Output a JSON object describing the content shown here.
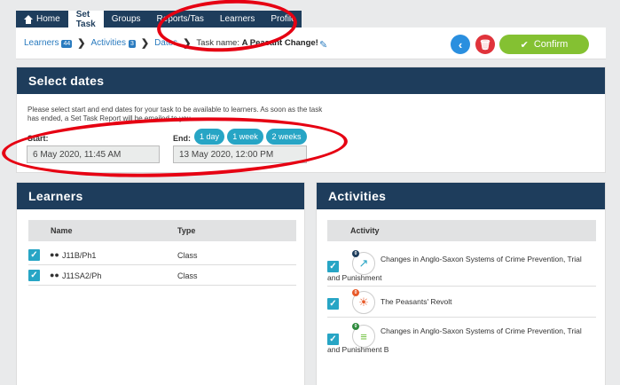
{
  "nav": {
    "tabs": [
      {
        "label": "Home",
        "icon": "home-icon"
      },
      {
        "label": "Set Task"
      },
      {
        "label": "Groups"
      },
      {
        "label": "Reports/Tas"
      },
      {
        "label": "Learners"
      },
      {
        "label": "Profile"
      }
    ],
    "active_tab": "Set Task"
  },
  "breadcrumb": {
    "learners": "Learners",
    "learners_count": "44",
    "activities": "Activities",
    "activities_count": "3",
    "dates": "Dates",
    "task_label": "Task name:",
    "task_name": "A Peasant Change!"
  },
  "actions": {
    "back_icon": "chevron-left-icon",
    "delete_icon": "trash-icon",
    "confirm_label": "Confirm"
  },
  "select_dates": {
    "title": "Select dates",
    "description": "Please select start and end dates for your task to be available to learners. As soon as the task has ended, a Set Task Report will be emailed to you.",
    "start_label": "Start:",
    "end_label": "End:",
    "quick_options": [
      "1 day",
      "1 week",
      "2 weeks"
    ],
    "start_value": "6 May 2020, 11:45 AM",
    "end_value": "13 May 2020, 12:00 PM"
  },
  "learners": {
    "title": "Learners",
    "columns": [
      "Name",
      "Type"
    ],
    "rows": [
      {
        "name": "J11B/Ph1",
        "type": "Class",
        "checked": true
      },
      {
        "name": "J11SA2/Ph",
        "type": "Class",
        "checked": true
      }
    ]
  },
  "activities": {
    "title": "Activities",
    "column": "Activity",
    "rows": [
      {
        "title": "Changes in Anglo-Saxon Systems of Crime Prevention, Trial and Punishment",
        "badge": "0",
        "badge_color": "#1e3d5c",
        "icon": "external-link-icon",
        "checked": true
      },
      {
        "title": "The Peasants' Revolt",
        "badge": "0",
        "badge_color": "#e85a2a",
        "icon": "sun-icon",
        "checked": true
      },
      {
        "title": "Changes in Anglo-Saxon Systems of Crime Prevention, Trial and Punishment B",
        "badge": "0",
        "badge_color": "#2e8b3d",
        "icon": "notes-icon",
        "checked": true
      }
    ]
  },
  "colors": {
    "header_navy": "#1e3d5c",
    "link_blue": "#2a7bbf",
    "teal": "#27a5c5",
    "confirm_green": "#84c132",
    "delete_red": "#e0333b",
    "annotation_red": "#e60012"
  }
}
